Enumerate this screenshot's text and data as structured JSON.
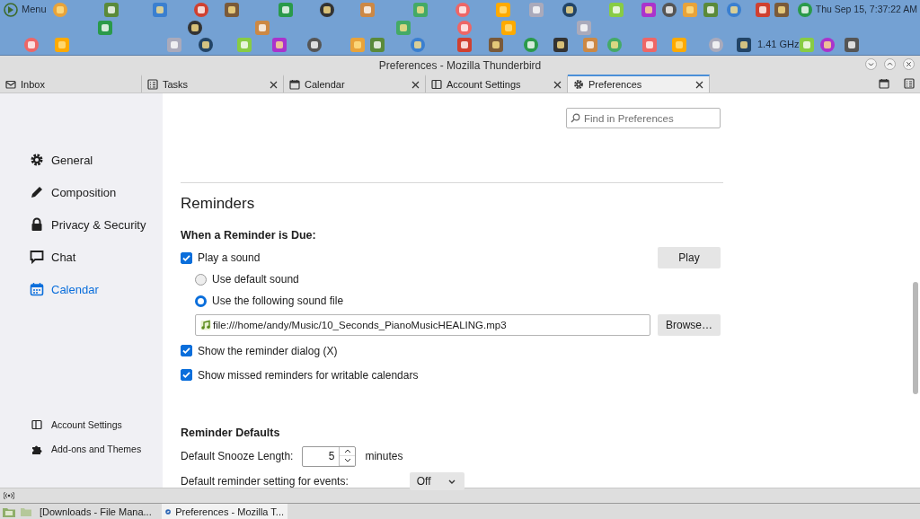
{
  "panel": {
    "menu_label": "Menu",
    "cpu": "1.41 GHz",
    "clock": "Thu Sep 15,  7:37:22 AM"
  },
  "window": {
    "title": "Preferences - Mozilla Thunderbird"
  },
  "tabs": [
    {
      "label": "Inbox",
      "kind": "mail",
      "selected": false,
      "closable": false
    },
    {
      "label": "Tasks",
      "kind": "tasks",
      "selected": false,
      "closable": true
    },
    {
      "label": "Calendar",
      "kind": "calendar",
      "selected": false,
      "closable": true
    },
    {
      "label": "Account Settings",
      "kind": "account",
      "selected": false,
      "closable": true
    },
    {
      "label": "Preferences",
      "kind": "gear",
      "selected": true,
      "closable": true
    }
  ],
  "sidebar": {
    "items": [
      {
        "label": "General",
        "kind": "gear",
        "selected": false
      },
      {
        "label": "Composition",
        "kind": "pen",
        "selected": false
      },
      {
        "label": "Privacy & Security",
        "kind": "lock",
        "selected": false
      },
      {
        "label": "Chat",
        "kind": "chat",
        "selected": false
      },
      {
        "label": "Calendar",
        "kind": "calendar",
        "selected": true
      }
    ],
    "footer_items": [
      {
        "label": "Account Settings",
        "kind": "account"
      },
      {
        "label": "Add-ons and Themes",
        "kind": "puzzle"
      }
    ]
  },
  "search": {
    "placeholder": "Find in Preferences"
  },
  "reminders": {
    "title": "Reminders",
    "due_heading": "When a Reminder is Due:",
    "play_sound": {
      "label": "Play a sound",
      "checked": true
    },
    "play_button": "Play",
    "sound_choices": [
      {
        "label": "Use default sound",
        "selected": false
      },
      {
        "label": "Use the following sound file",
        "selected": true
      }
    ],
    "sound_file": "file:///home/andy/Music/10_Seconds_PianoMusicHEALING.mp3",
    "browse_button": "Browse…",
    "options": [
      {
        "label": "Show the reminder dialog (X)",
        "checked": true
      },
      {
        "label": "Show missed reminders for writable calendars",
        "checked": true
      }
    ]
  },
  "defaults": {
    "title": "Reminder Defaults",
    "snooze_label": "Default Snooze Length:",
    "snooze_value": "5",
    "snooze_unit": "minutes",
    "event_label": "Default reminder setting for events:",
    "event_value": "Off"
  },
  "taskbar": [
    {
      "label": "[Downloads - File Mana...",
      "selected": false
    },
    {
      "label": "Preferences - Mozilla T...",
      "selected": true
    }
  ]
}
